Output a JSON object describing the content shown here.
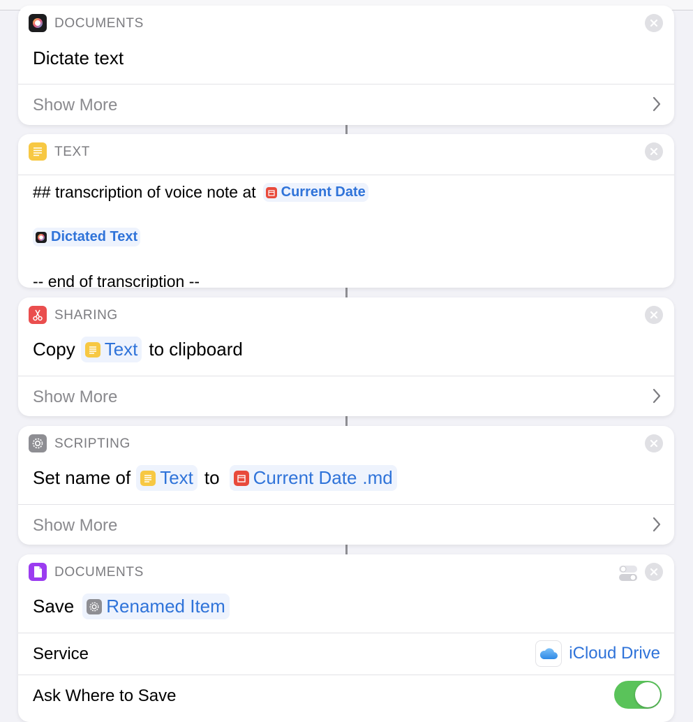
{
  "cards": [
    {
      "category": "DOCUMENTS",
      "category_icon": "dictate-waveform-icon",
      "action": "Dictate text",
      "show_more": "Show More"
    },
    {
      "category": "TEXT",
      "category_icon": "text-lines-icon",
      "line1": "## transcription of voice note at",
      "line1_token": "Current Date",
      "line2_token": "Dictated Text",
      "line3": "-- end of transcription --"
    },
    {
      "category": "SHARING",
      "category_icon": "scissors-icon",
      "word1": "Copy",
      "token": "Text",
      "word2": "to clipboard",
      "show_more": "Show More"
    },
    {
      "category": "SCRIPTING",
      "category_icon": "gear-icon",
      "word1": "Set name of",
      "token1": "Text",
      "word2": "to",
      "token2": "Current Date",
      "token2_suffix": ".md",
      "show_more": "Show More"
    },
    {
      "category": "DOCUMENTS",
      "category_icon": "document-icon",
      "word1": "Save",
      "token": "Renamed Item",
      "service_label": "Service",
      "service_value": "iCloud Drive",
      "ask_label": "Ask Where to Save",
      "ask_enabled": true
    }
  ],
  "colors": {
    "token_blue": "#2f73d9",
    "documents_dark": "#1c1c1e",
    "text_yellow": "#f7c843",
    "sharing_red": "#ea4e4e",
    "scripting_gray": "#8e8e93",
    "documents_purple": "#9b3cf0",
    "calendar_red": "#e84a3c",
    "toggle_green": "#5ac35a"
  }
}
